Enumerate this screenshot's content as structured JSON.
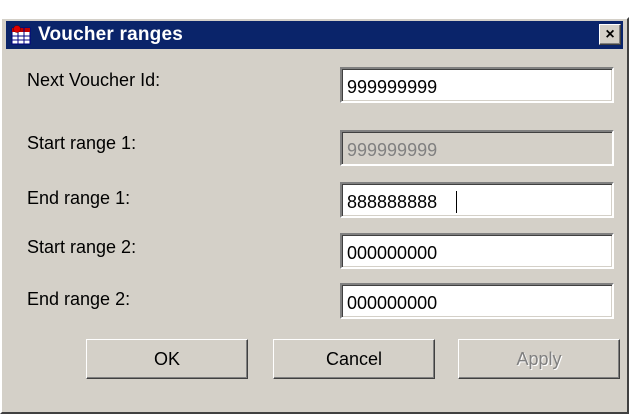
{
  "window": {
    "title": "Voucher ranges",
    "close_glyph": "×"
  },
  "fields": [
    {
      "label": "Next Voucher Id:",
      "value": "999999999",
      "disabled": false
    },
    {
      "label": "Start range 1:",
      "value": "999999999",
      "disabled": true
    },
    {
      "label": "End  range 1:",
      "value": "888888888",
      "disabled": false,
      "focused": true
    },
    {
      "label": "Start range 2:",
      "value": "000000000",
      "disabled": false
    },
    {
      "label": "End  range 2:",
      "value": "000000000",
      "disabled": false
    }
  ],
  "buttons": {
    "ok": "OK",
    "cancel": "Cancel",
    "apply": "Apply"
  },
  "colors": {
    "titlebar": "#0a246a",
    "face": "#d4d0c8"
  },
  "icons": {
    "app": "grid-table-icon",
    "close": "close-icon"
  }
}
